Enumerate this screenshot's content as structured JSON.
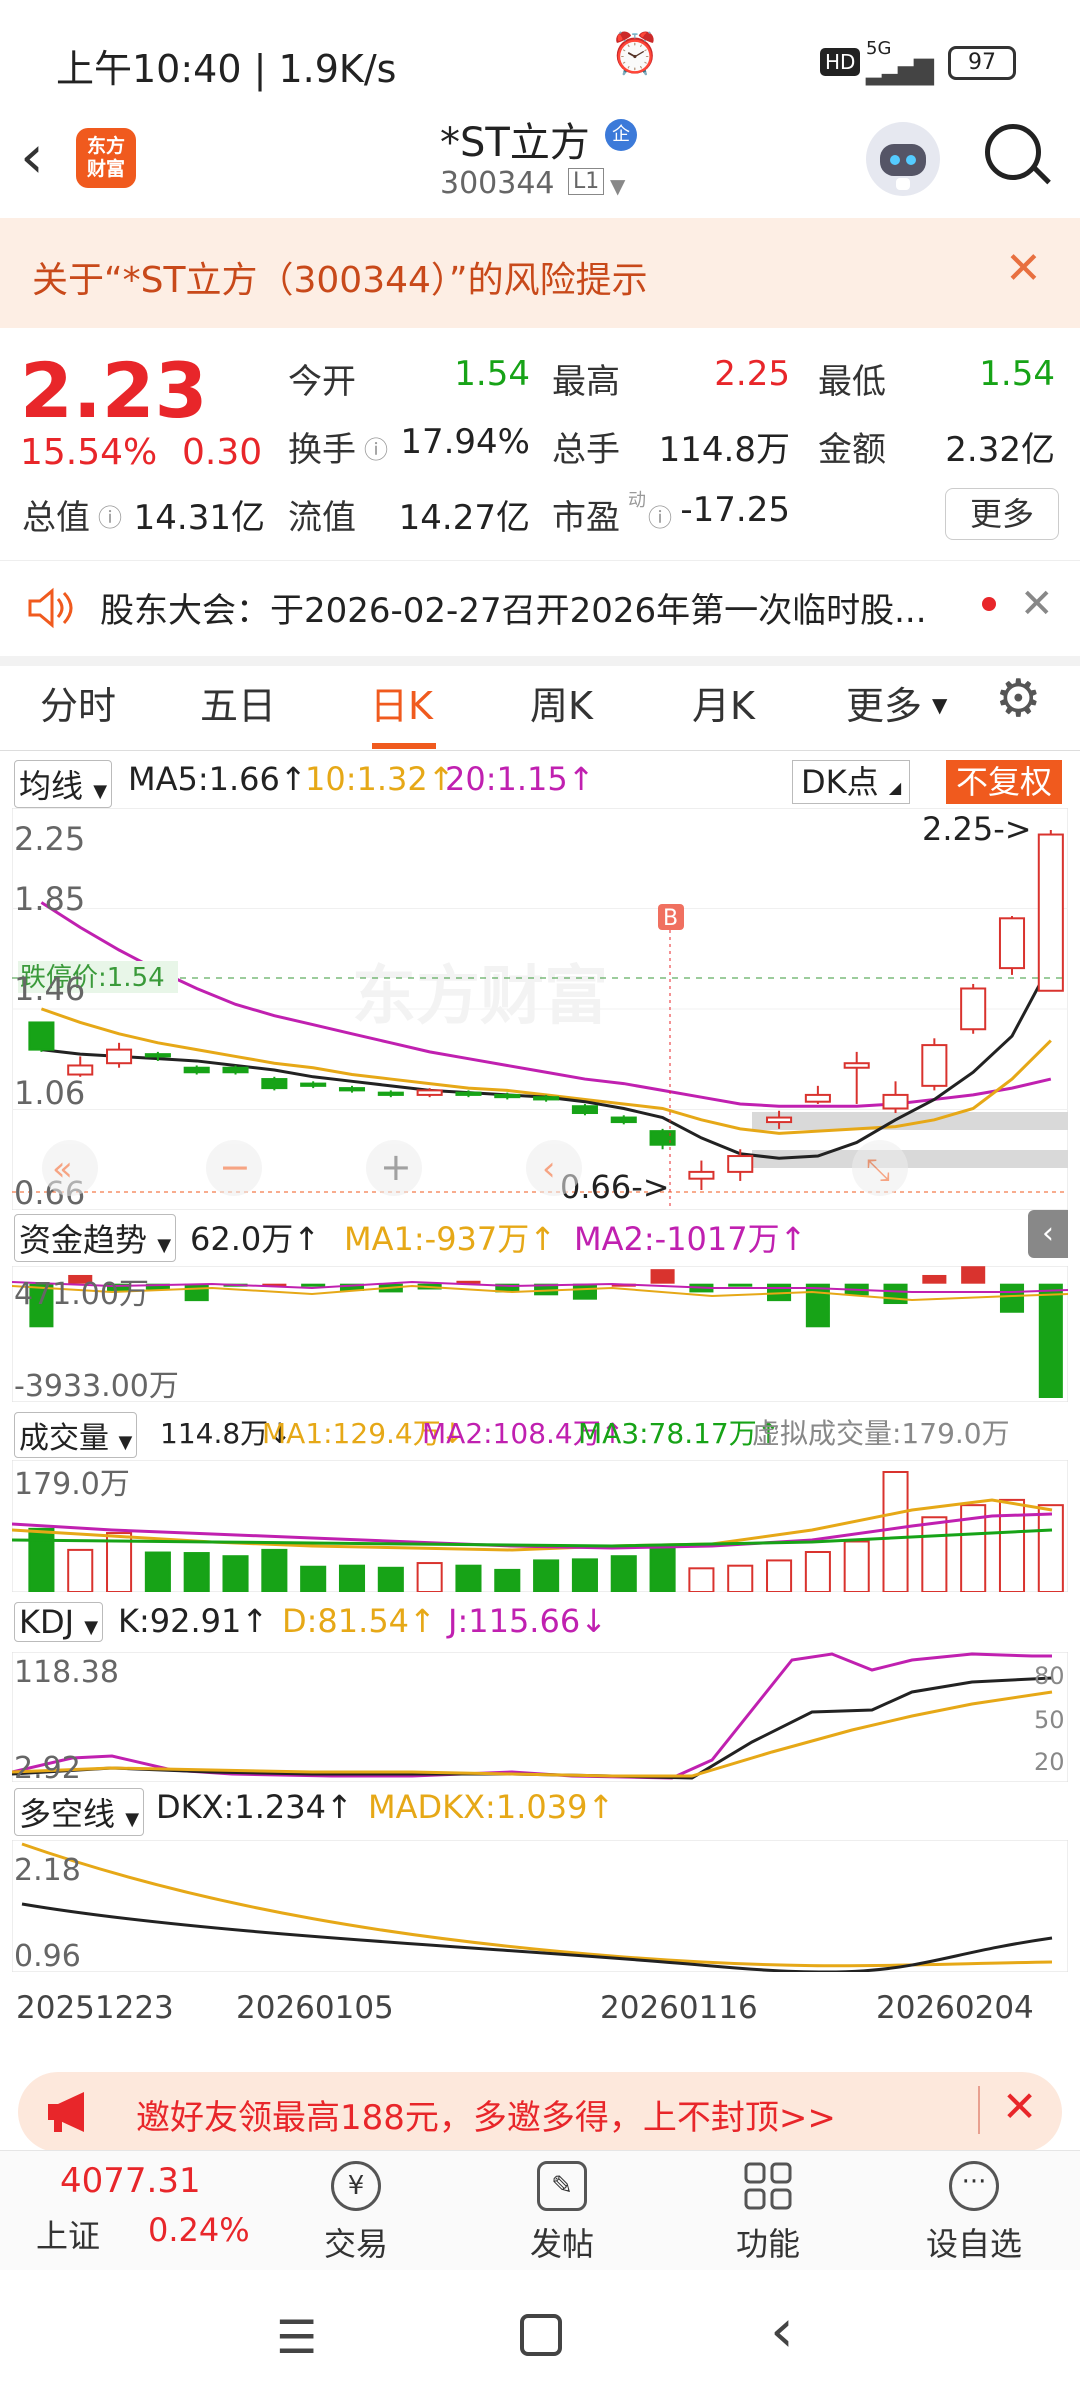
{
  "status": {
    "time": "上午10:40 | 1.9K/s",
    "network": "5G",
    "battery": "97",
    "hd": "HD"
  },
  "nav": {
    "logo_line1": "东方",
    "logo_line2": "财富",
    "name": "*ST立方",
    "qi_badge": "企",
    "code": "300344",
    "level": "L1"
  },
  "risk_banner": {
    "text": "关于“*ST立方（300344）”的风险提示"
  },
  "quote": {
    "price": "2.23",
    "change_pct": "15.54%",
    "change": "0.30",
    "open_label": "今开",
    "open": "1.54",
    "high_label": "最高",
    "high": "2.25",
    "low_label": "最低",
    "low": "1.54",
    "turnover_label": "换手",
    "turnover": "17.94%",
    "volume_label": "总手",
    "volume": "114.8万",
    "amount_label": "金额",
    "amount": "2.32亿",
    "mktcap_label": "总值",
    "mktcap": "14.31亿",
    "float_label": "流值",
    "float": "14.27亿",
    "pe_label": "市盈",
    "pe_sup": "动",
    "pe": "-17.25",
    "more": "更多"
  },
  "notice": {
    "text": "股东大会：于2026-02-27召开2026年第一次临时股..."
  },
  "tabs": [
    "分时",
    "五日",
    "日K",
    "周K",
    "月K",
    "更多"
  ],
  "chart_header": {
    "ma_select": "均线",
    "ma5": "MA5:1.66↑",
    "ma10": "10:1.32↑",
    "ma20": "20:1.15↑",
    "dk": "DK点",
    "fq": "不复权"
  },
  "chart_labels": {
    "y1": "2.25",
    "y2": "1.85",
    "y3": "1.46",
    "y4": "1.06",
    "y5": "0.66",
    "limit": "跌停价:1.54",
    "hi_mark": "2.25->",
    "lo_mark": "0.66->",
    "b_mark": "B",
    "watermark": "东方财富"
  },
  "fund": {
    "select": "资金趋势",
    "value": "62.0万↑",
    "ma1": "MA1:-937万↑",
    "ma2": "MA2:-1017万↑",
    "y_top": "471.00万",
    "y_bot": "-3933.00万"
  },
  "vol": {
    "select": "成交量",
    "value": "114.8万↓",
    "ma1": "MA1:129.4万↓",
    "ma2": "MA2:108.4万↑",
    "ma3": "MA3:78.17万↑",
    "virtual": "虚拟成交量:179.0万",
    "y_top": "179.0万"
  },
  "kdj": {
    "select": "KDJ",
    "k": "K:92.91↑",
    "d": "D:81.54↑",
    "j": "J:115.66↓",
    "y_top": "118.38",
    "y_bot": "2.92",
    "r80": "80",
    "r50": "50",
    "r20": "20"
  },
  "dkx": {
    "select": "多空线",
    "dkx": "DKX:1.234↑",
    "madkx": "MADKX:1.039↑",
    "y_top": "2.18",
    "y_bot": "0.96"
  },
  "dates": [
    "20251223",
    "20260105",
    "20260116",
    "20260204"
  ],
  "promo": {
    "text": "邀好友领最高188元，多邀多得，上不封顶>>"
  },
  "bottom": {
    "index_value": "4077.31",
    "index_name": "上证",
    "index_chg": "0.24%",
    "buttons": [
      "交易",
      "发帖",
      "功能",
      "设自选"
    ]
  },
  "chart_data": {
    "type": "candlestick",
    "candles": [
      {
        "o": 1.4,
        "c": 1.28,
        "h": 1.4,
        "l": 1.27
      },
      {
        "o": 1.17,
        "c": 1.21,
        "h": 1.25,
        "l": 1.16
      },
      {
        "o": 1.22,
        "c": 1.28,
        "h": 1.31,
        "l": 1.2
      },
      {
        "o": 1.26,
        "c": 1.25,
        "h": 1.27,
        "l": 1.23
      },
      {
        "o": 1.2,
        "c": 1.18,
        "h": 1.21,
        "l": 1.17
      },
      {
        "o": 1.2,
        "c": 1.18,
        "h": 1.21,
        "l": 1.17
      },
      {
        "o": 1.15,
        "c": 1.11,
        "h": 1.16,
        "l": 1.1
      },
      {
        "o": 1.13,
        "c": 1.12,
        "h": 1.14,
        "l": 1.11
      },
      {
        "o": 1.11,
        "c": 1.1,
        "h": 1.12,
        "l": 1.09
      },
      {
        "o": 1.09,
        "c": 1.08,
        "h": 1.1,
        "l": 1.07
      },
      {
        "o": 1.08,
        "c": 1.1,
        "h": 1.11,
        "l": 1.07
      },
      {
        "o": 1.09,
        "c": 1.08,
        "h": 1.1,
        "l": 1.07
      },
      {
        "o": 1.08,
        "c": 1.07,
        "h": 1.09,
        "l": 1.06
      },
      {
        "o": 1.07,
        "c": 1.06,
        "h": 1.08,
        "l": 1.05
      },
      {
        "o": 1.03,
        "c": 1.0,
        "h": 1.04,
        "l": 0.99
      },
      {
        "o": 0.98,
        "c": 0.96,
        "h": 0.99,
        "l": 0.95
      },
      {
        "o": 0.92,
        "c": 0.86,
        "h": 0.93,
        "l": 0.84
      },
      {
        "o": 0.71,
        "c": 0.74,
        "h": 0.79,
        "l": 0.66
      },
      {
        "o": 0.74,
        "c": 0.81,
        "h": 0.84,
        "l": 0.7
      },
      {
        "o": 0.96,
        "c": 0.98,
        "h": 1.01,
        "l": 0.93
      },
      {
        "o": 1.05,
        "c": 1.08,
        "h": 1.12,
        "l": 1.04
      },
      {
        "o": 1.2,
        "c": 1.22,
        "h": 1.27,
        "l": 1.04
      },
      {
        "o": 1.02,
        "c": 1.08,
        "h": 1.14,
        "l": 1.0
      },
      {
        "o": 1.12,
        "c": 1.3,
        "h": 1.33,
        "l": 1.1
      },
      {
        "o": 1.37,
        "c": 1.55,
        "h": 1.57,
        "l": 1.35
      },
      {
        "o": 1.64,
        "c": 1.86,
        "h": 1.87,
        "l": 1.61
      },
      {
        "o": 1.54,
        "c": 2.23,
        "h": 2.25,
        "l": 1.54
      }
    ],
    "ma5": [
      1.28,
      1.26,
      1.25,
      1.24,
      1.23,
      1.21,
      1.19,
      1.16,
      1.14,
      1.12,
      1.1,
      1.09,
      1.08,
      1.07,
      1.05,
      1.02,
      0.98,
      0.89,
      0.82,
      0.8,
      0.81,
      0.87,
      0.97,
      1.06,
      1.18,
      1.34,
      1.66
    ],
    "ma10": [
      1.46,
      1.4,
      1.35,
      1.31,
      1.28,
      1.25,
      1.22,
      1.2,
      1.17,
      1.15,
      1.13,
      1.11,
      1.1,
      1.08,
      1.06,
      1.04,
      1.02,
      0.97,
      0.93,
      0.91,
      0.92,
      0.93,
      0.94,
      0.97,
      1.02,
      1.15,
      1.32
    ],
    "ma20": [
      1.93,
      1.82,
      1.72,
      1.63,
      1.55,
      1.48,
      1.43,
      1.39,
      1.35,
      1.31,
      1.27,
      1.24,
      1.21,
      1.18,
      1.15,
      1.13,
      1.1,
      1.07,
      1.04,
      1.03,
      1.03,
      1.03,
      1.04,
      1.06,
      1.08,
      1.11,
      1.15
    ],
    "ylim": [
      0.66,
      2.25
    ],
    "volume": [
      120,
      80,
      112,
      75,
      74,
      68,
      80,
      48,
      50,
      46,
      55,
      50,
      42,
      60,
      62,
      68,
      86,
      45,
      50,
      60,
      76,
      96,
      228,
      142,
      165,
      175,
      165
    ],
    "fund": [
      -1500,
      300,
      -250,
      -200,
      -600,
      -50,
      0,
      -100,
      -250,
      -300,
      -200,
      100,
      -300,
      -400,
      -550,
      0,
      500,
      -300,
      -100,
      -600,
      -1500,
      -400,
      -700,
      300,
      600,
      -1000,
      -3933
    ]
  }
}
